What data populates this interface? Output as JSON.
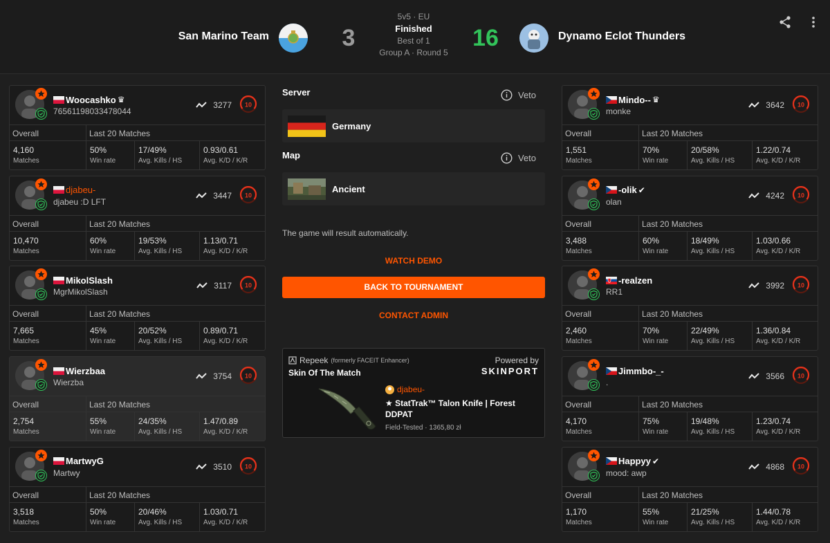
{
  "header": {
    "team1": {
      "name": "San Marino Team",
      "score": "3"
    },
    "team2": {
      "name": "Dynamo Eclot Thunders",
      "score": "16"
    },
    "format": "5v5 · EU",
    "status": "Finished",
    "best_of": "Best of 1",
    "group_round": "Group A · Round 5",
    "icons": [
      "share-icon",
      "more-vertical-icon"
    ],
    "colors": {
      "loser_score": "#9a9a9a",
      "winner_score": "#32c35a",
      "accent": "#ff5500"
    }
  },
  "card_labels": {
    "overall": "Overall",
    "last20": "Last 20 Matches",
    "matches": "Matches",
    "winrate": "Win rate",
    "kills_hs": "Avg. Kills / HS",
    "kd_kr": "Avg. K/D / K/R"
  },
  "team1_players": [
    {
      "name": "Woocashko",
      "name_suffix": "♛",
      "flag": "pl",
      "sub": "76561198033478044",
      "elo": "3277",
      "level": "10",
      "matches": "4,160",
      "winrate": "50%",
      "kills_hs": "17/49%",
      "kd_kr": "0.93/0.61",
      "orange_name": false,
      "highlight": false
    },
    {
      "name": "djabeu-",
      "name_suffix": "",
      "flag": "pl",
      "sub": "djabeu :D LFT",
      "elo": "3447",
      "level": "10",
      "matches": "10,470",
      "winrate": "60%",
      "kills_hs": "19/53%",
      "kd_kr": "1.13/0.71",
      "orange_name": true,
      "highlight": false
    },
    {
      "name": "MikolSlash",
      "name_suffix": "",
      "flag": "pl",
      "sub": "MgrMikolSlash",
      "elo": "3117",
      "level": "10",
      "matches": "7,665",
      "winrate": "45%",
      "kills_hs": "20/52%",
      "kd_kr": "0.89/0.71",
      "orange_name": false,
      "highlight": false
    },
    {
      "name": "Wierzbaa",
      "name_suffix": "",
      "flag": "pl",
      "sub": "Wierzba",
      "elo": "3754",
      "level": "10",
      "matches": "2,754",
      "winrate": "55%",
      "kills_hs": "24/35%",
      "kd_kr": "1.47/0.89",
      "orange_name": false,
      "highlight": true
    },
    {
      "name": "MartwyG",
      "name_suffix": "",
      "flag": "pl",
      "sub": "Martwy",
      "elo": "3510",
      "level": "10",
      "matches": "3,518",
      "winrate": "50%",
      "kills_hs": "20/46%",
      "kd_kr": "1.03/0.71",
      "orange_name": false,
      "highlight": false
    }
  ],
  "team2_players": [
    {
      "name": "Mindo--",
      "name_suffix": "♛",
      "flag": "cz",
      "sub": "monke",
      "elo": "3642",
      "level": "10",
      "matches": "1,551",
      "winrate": "70%",
      "kills_hs": "20/58%",
      "kd_kr": "1.22/0.74",
      "orange_name": false,
      "highlight": false
    },
    {
      "name": "-olik",
      "name_suffix": "✔",
      "flag": "cz",
      "sub": "olan",
      "elo": "4242",
      "level": "10",
      "matches": "3,488",
      "winrate": "60%",
      "kills_hs": "18/49%",
      "kd_kr": "1.03/0.66",
      "orange_name": false,
      "highlight": false
    },
    {
      "name": "-realzen",
      "name_suffix": "",
      "flag": "sk",
      "sub": "RR1",
      "elo": "3992",
      "level": "10",
      "matches": "2,460",
      "winrate": "70%",
      "kills_hs": "22/49%",
      "kd_kr": "1.36/0.84",
      "orange_name": false,
      "highlight": false
    },
    {
      "name": "Jimmbo-_-",
      "name_suffix": "",
      "flag": "cz",
      "sub": ".",
      "elo": "3566",
      "level": "10",
      "matches": "4,170",
      "winrate": "75%",
      "kills_hs": "19/48%",
      "kd_kr": "1.23/0.74",
      "orange_name": false,
      "highlight": false
    },
    {
      "name": "Happyy",
      "name_suffix": "✔",
      "flag": "cz",
      "sub": "mood: awp",
      "elo": "4868",
      "level": "10",
      "matches": "1,170",
      "winrate": "55%",
      "kills_hs": "21/25%",
      "kd_kr": "1.44/0.78",
      "orange_name": false,
      "highlight": false
    }
  ],
  "center": {
    "server_label": "Server",
    "server_value": "Germany",
    "map_label": "Map",
    "map_value": "Ancient",
    "veto_label": "Veto",
    "auto_result_text": "The game will result automatically.",
    "watch_demo": "WATCH DEMO",
    "back_to_tournament": "BACK TO TOURNAMENT",
    "contact_admin": "CONTACT ADMIN"
  },
  "skin_of_match": {
    "brand": "Repeek",
    "brand_note": "(formerly FACEIT Enhancer)",
    "title": "Skin Of The Match",
    "powered_by": "Powered by",
    "partner": "SKINPORT",
    "player": "djabeu-",
    "item": "★ StatTrak™ Talon Knife | Forest DDPAT",
    "meta": "Field-Tested · 1365,80 zł"
  }
}
